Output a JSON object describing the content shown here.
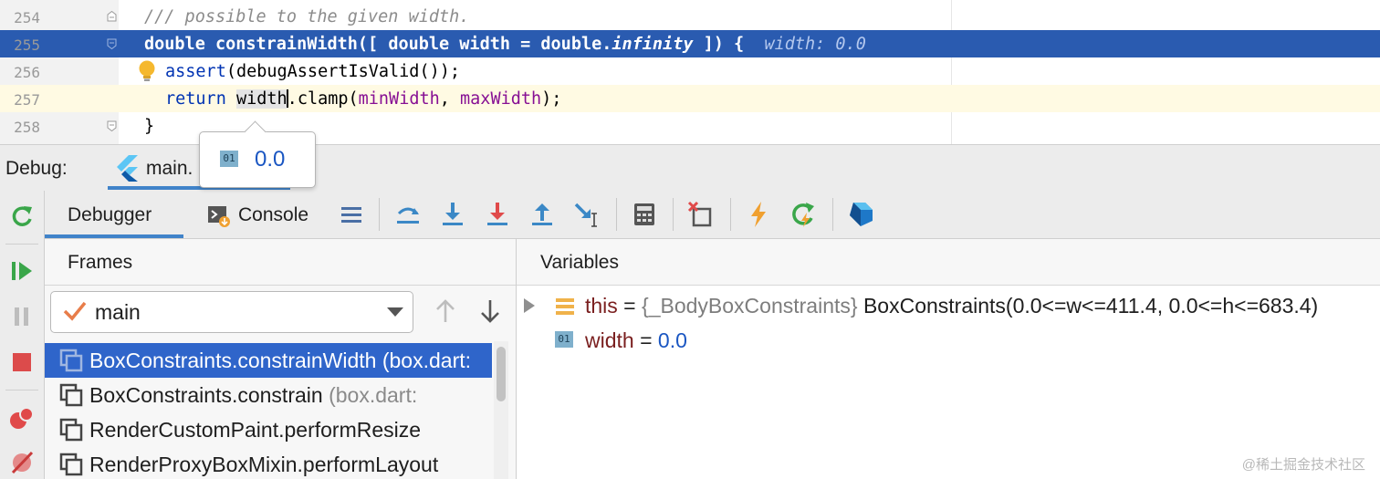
{
  "editor": {
    "lines": [
      {
        "number": "254",
        "comment": "/// possible to the given width."
      },
      {
        "number": "255",
        "kw1": "double",
        "name": "constrainWidth",
        "p1": "([ ",
        "kw2": "double",
        "param": " width = ",
        "kw3": "double.",
        "inf": "infinity",
        "p2": " ]) {",
        "inline_value": "width: 0.0"
      },
      {
        "number": "256",
        "fn": "assert",
        "rest": "(debugAssertIsValid());"
      },
      {
        "number": "257",
        "kw": "return",
        "word": "width",
        "dot": ".",
        "call": "clamp(",
        "a1": "minWidth",
        "comma": ", ",
        "a2": "maxWidth",
        "end": ");"
      },
      {
        "number": "258",
        "brace": "}"
      }
    ]
  },
  "tooltip": {
    "icon_text": "01",
    "value": "0.0"
  },
  "debug_bar": {
    "label": "Debug:",
    "tab_label": "main."
  },
  "debug_tabs": {
    "debugger": "Debugger",
    "console": "Console"
  },
  "frames": {
    "title": "Frames",
    "thread": "main",
    "items": [
      {
        "name": "BoxConstraints.constrainWidth ",
        "source": "(box.dart:"
      },
      {
        "name": "BoxConstraints.constrain ",
        "source": "(box.dart:"
      },
      {
        "name": "RenderCustomPaint.performResize",
        "source": ""
      },
      {
        "name": "RenderProxyBoxMixin.performLayout",
        "source": ""
      }
    ]
  },
  "variables": {
    "title": "Variables",
    "items": [
      {
        "name": "this",
        "eq": " = ",
        "type": "{_BodyBoxConstraints} ",
        "value": "BoxConstraints(0.0<=w<=411.4, 0.0<=h<=683.4)"
      },
      {
        "icon_text": "01",
        "name": "width",
        "eq": " = ",
        "value": "0.0"
      }
    ]
  },
  "watermark": "@稀土掘金技术社区",
  "colors": {
    "selection": "#2a5bb0",
    "accent": "#4083c9",
    "number": "#1a56c2"
  }
}
